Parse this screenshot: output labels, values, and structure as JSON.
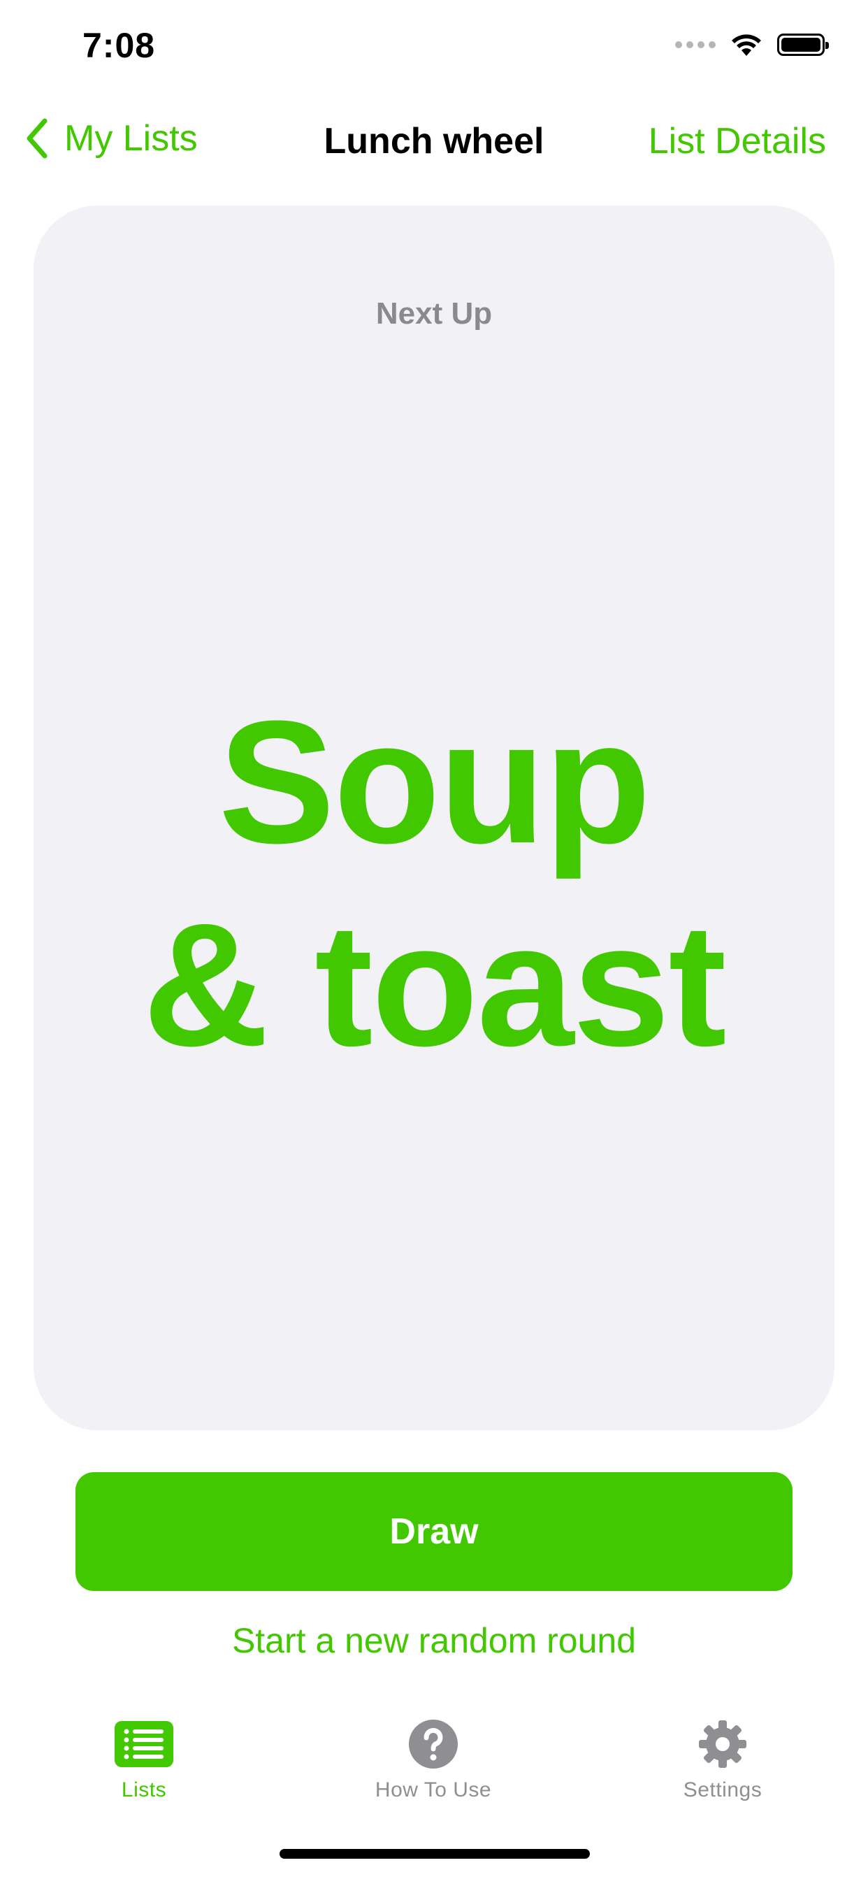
{
  "status_bar": {
    "time": "7:08"
  },
  "nav": {
    "back_label": "My Lists",
    "title": "Lunch wheel",
    "right_label": "List Details"
  },
  "card": {
    "label": "Next Up",
    "item_line1": "Soup",
    "item_line2": "& toast"
  },
  "actions": {
    "draw_label": "Draw",
    "new_round_label": "Start a new random round"
  },
  "tabbar": {
    "tabs": [
      {
        "label": "Lists",
        "icon": "list-icon",
        "selected": true
      },
      {
        "label": "How To Use",
        "icon": "question-icon",
        "selected": false
      },
      {
        "label": "Settings",
        "icon": "gear-icon",
        "selected": false
      }
    ]
  },
  "colors": {
    "accent": "#42c800",
    "card_background": "#f1f1f6",
    "secondary_text": "#8a8a8e",
    "inactive_tab": "#8e8e93"
  }
}
